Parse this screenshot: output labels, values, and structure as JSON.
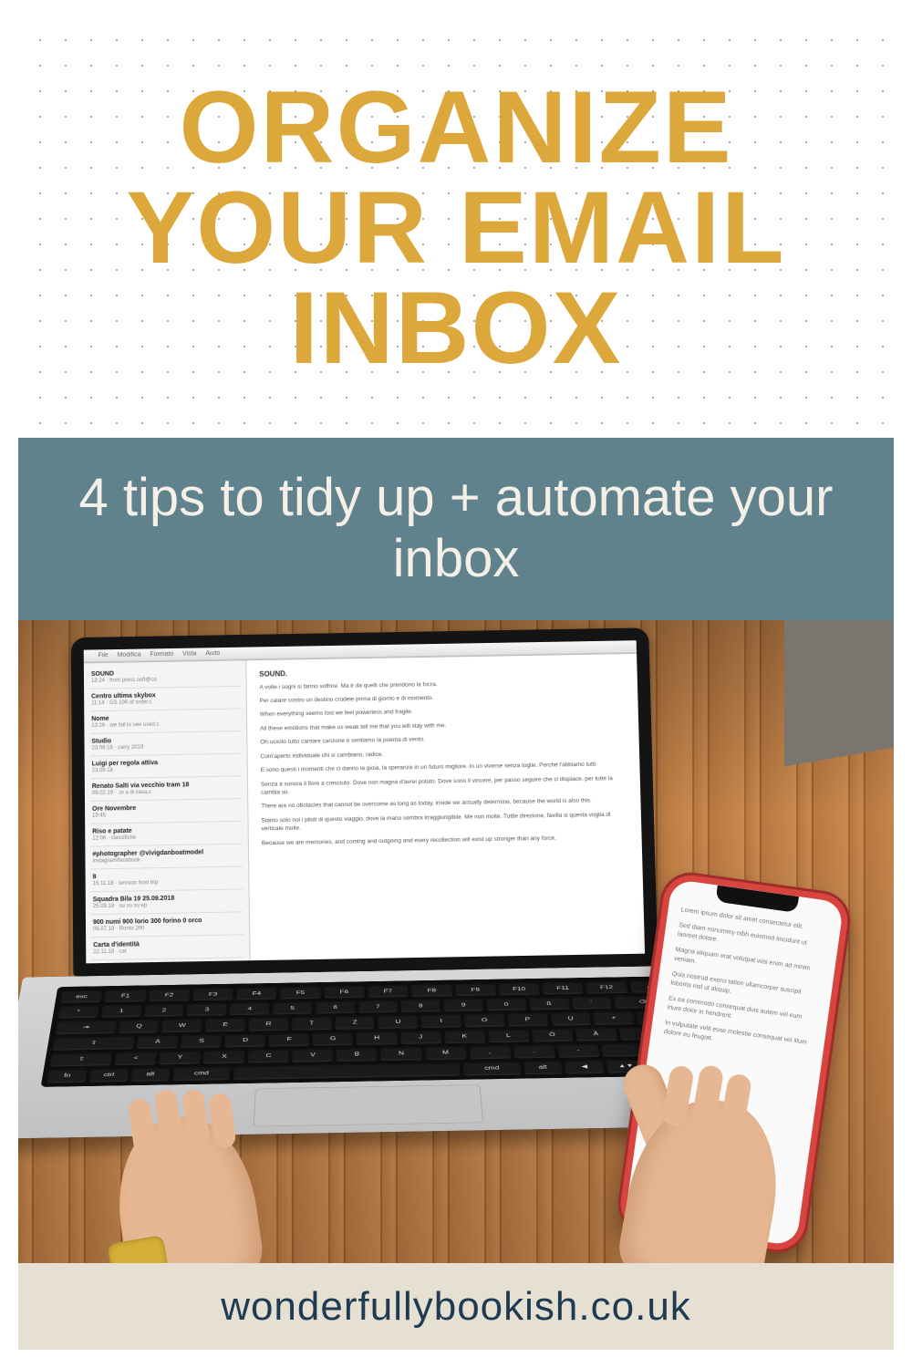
{
  "header": {
    "title": "ORGANIZE YOUR EMAIL INBOX"
  },
  "subbar": {
    "text": "4 tips to tidy up + automate your inbox"
  },
  "laptop": {
    "menubar": [
      "File",
      "Modifica",
      "Formato",
      "Vista",
      "Aiuto"
    ],
    "inbox": [
      {
        "title": "SOUND",
        "meta": "18:24 · from press.soft@co"
      },
      {
        "title": "Centro ultima skybox",
        "meta": "11:14 · GS 106 of order.c"
      },
      {
        "title": "Nome",
        "meta": "13:26 · we fail to see used.c"
      },
      {
        "title": "Studio",
        "meta": "23.09.18 · carry 2019"
      },
      {
        "title": "Luigi per regola attiva",
        "meta": "23.09.18"
      },
      {
        "title": "Renato Salti via vecchio tram 18",
        "meta": "09.02.19 · .in a di casa.c"
      },
      {
        "title": "Ore Novembre",
        "meta": "19:45"
      },
      {
        "title": "Riso e patate",
        "meta": "12:06 · classifiche"
      },
      {
        "title": "#photographer @vivigdanboatmodel",
        "meta": "instagram/facebook"
      },
      {
        "title": "8",
        "meta": "15.11.18 · session host trip"
      },
      {
        "title": "Squadra Bila 19 25.09.2018",
        "meta": "25.09.18 · su su su ep"
      },
      {
        "title": "900 numi 900 lorio 300 forino 0 orco",
        "meta": "06.07.18 · Ronto 200"
      },
      {
        "title": "Carta d'identità",
        "meta": "22.11.18 · cat"
      }
    ],
    "reader": {
      "subject": "SOUND.",
      "lines": [
        "A volte i sogni si fanno soffrire. Ma è da quelli che prendono la forza.",
        "Per calare contro un destino crudele prima di giorno e di momento.",
        "When everything seems lost we feel powerless and fragile.",
        "All these emotions that make us weak tell me that you will stay with me.",
        "Oh.ucicito tutto cantare canzone e sentiamo la poema di vento.",
        "Com'aperto individuale chi si cambiano, radice.",
        "E sono questi i momenti che ci danno la gioia, la speranza in un futuro migliore. In un viverse senza toglie. Perché l'abbiamo tutti.",
        "Senza a sonora il fiore a cresciuto. Dove non magna d'avrei potuto. Dove sono il vincere, per passo seguire che ci dispiace, per tutte la cambia su.",
        "There are no obstacles that cannot be overcome as long as today, inside we actually determine, because the world is also this.",
        "Siamo solo noi i piloti di questo viaggio, dove la mano sembra irraggiungibile. Me non molte. Tuttle direzione, favilla si questa voglia di verticale molle.",
        "Because we are memories, and coming and outgoing and every recollection will exist up stronger than any force."
      ]
    }
  },
  "phone": {
    "lines": [
      "Lorem ipsum dolor sit amet consectetur elit.",
      "Sed diam nonummy nibh euismod tincidunt ut laoreet dolore.",
      "Magna aliquam erat volutpat wisi enim ad minim veniam.",
      "Quis nostrud exerci tation ullamcorper suscipit lobortis nisl ut aliquip.",
      "Ex ea commodo consequat duis autem vel eum iriure dolor in hendrerit.",
      "In vulputate velit esse molestie consequat vel illum dolore eu feugiat."
    ]
  },
  "footer": {
    "text": "wonderfullybookish.co.uk"
  },
  "colors": {
    "title": "#dda83b",
    "subbar_bg": "#5f828d",
    "subbar_text": "#f4f0e8",
    "footer_bg": "#e6e0d2",
    "footer_text": "#1f3a53",
    "phone_case": "#d8443e"
  }
}
